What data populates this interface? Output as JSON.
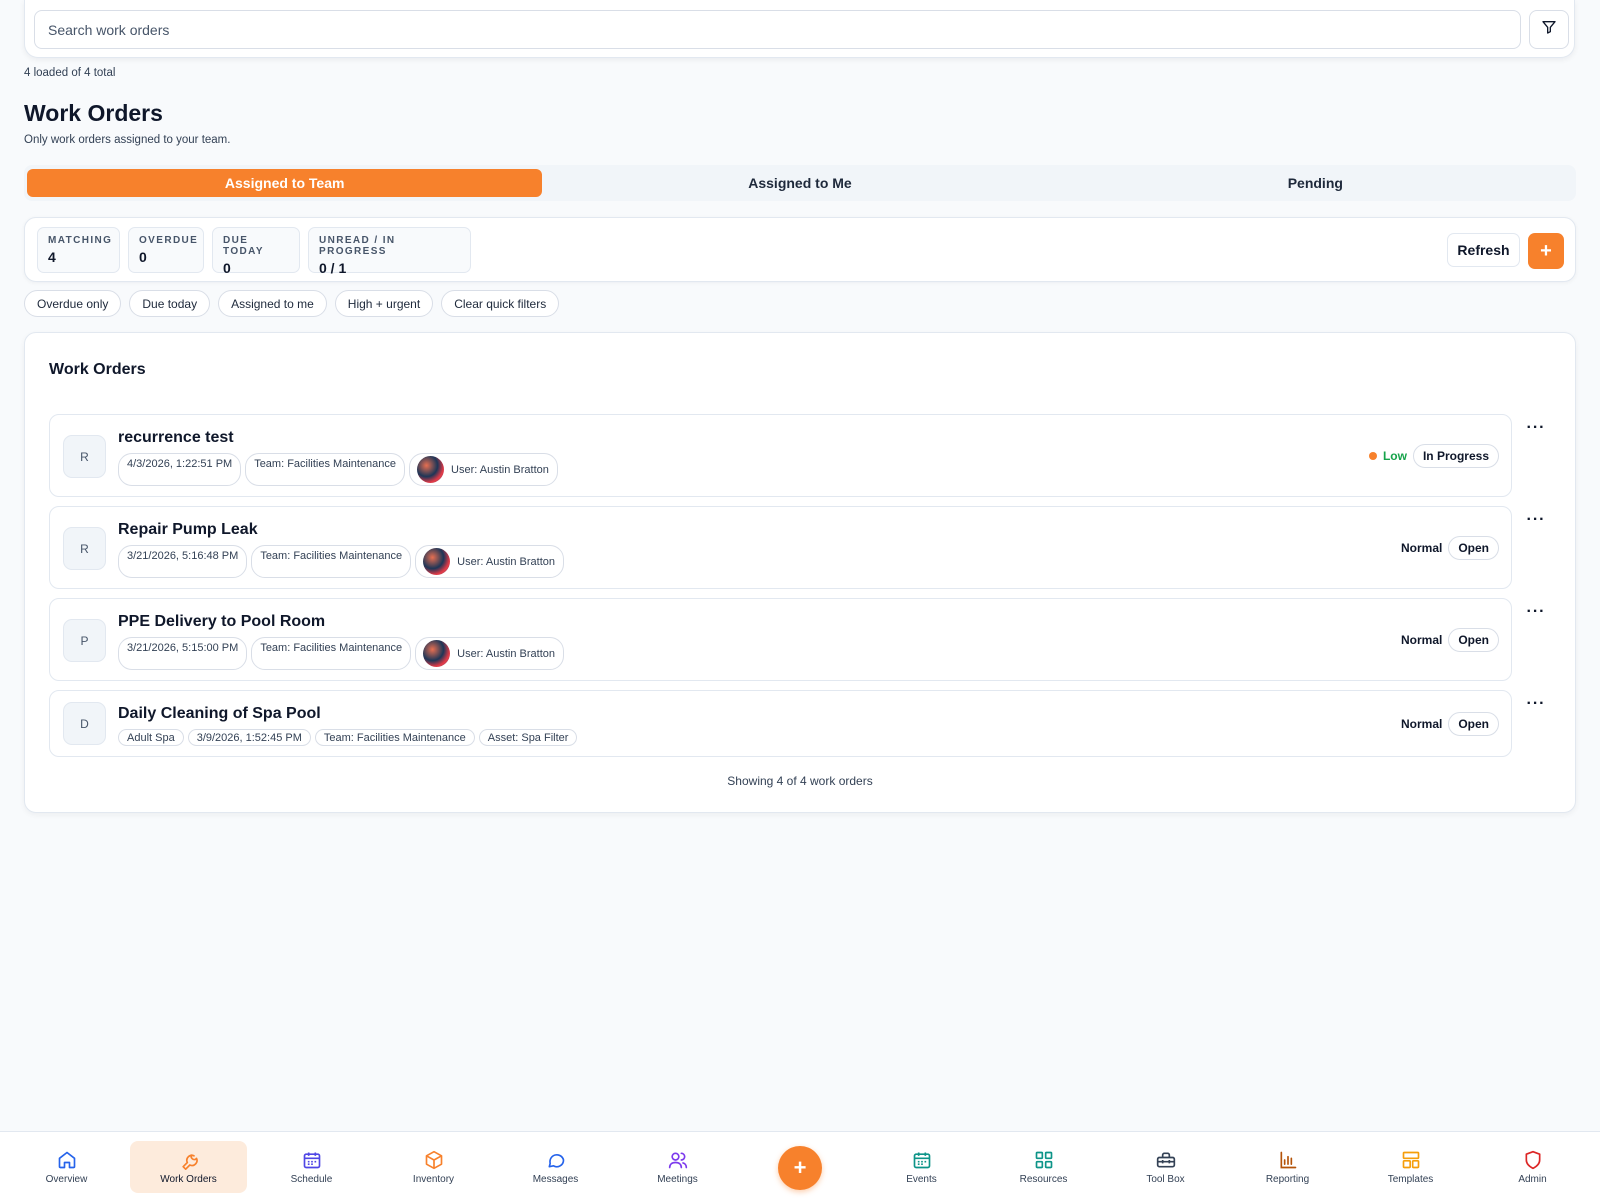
{
  "search": {
    "placeholder": "Search work orders"
  },
  "loaded_count": "4 loaded of 4 total",
  "page": {
    "title": "Work Orders",
    "subtitle": "Only work orders assigned to your team."
  },
  "tabs": [
    {
      "label": "Assigned to Team",
      "active": true
    },
    {
      "label": "Assigned to Me",
      "active": false
    },
    {
      "label": "Pending",
      "active": false
    }
  ],
  "stats": [
    {
      "label": "MATCHING",
      "value": "4"
    },
    {
      "label": "OVERDUE",
      "value": "0"
    },
    {
      "label": "DUE TODAY",
      "value": "0"
    },
    {
      "label": "UNREAD / IN PROGRESS",
      "value": "0 / 1"
    }
  ],
  "actions": {
    "refresh_label": "Refresh",
    "add_label": "+"
  },
  "quick_filters": [
    "Overdue only",
    "Due today",
    "Assigned to me",
    "High + urgent",
    "Clear quick filters"
  ],
  "work_orders": {
    "title": "Work Orders",
    "more_label": "···",
    "rows": [
      {
        "initial": "R",
        "title": "recurrence test",
        "date": "4/3/2026, 1:22:51 PM",
        "team": "Team: Facilities Maintenance",
        "user": "User: Austin Bratton",
        "priority": "Low",
        "status": "In Progress"
      },
      {
        "initial": "R",
        "title": "Repair Pump Leak",
        "date": "3/21/2026, 5:16:48 PM",
        "team": "Team: Facilities Maintenance",
        "user": "User: Austin Bratton",
        "priority": "Normal",
        "status": "Open"
      },
      {
        "initial": "P",
        "title": "PPE Delivery to Pool Room",
        "date": "3/21/2026, 5:15:00 PM",
        "team": "Team: Facilities Maintenance",
        "user": "User: Austin Bratton",
        "priority": "Normal",
        "status": "Open"
      },
      {
        "initial": "D",
        "title": "Daily Cleaning of Spa Pool",
        "location": "Adult Spa",
        "date": "3/9/2026, 1:52:45 PM",
        "team": "Team: Facilities Maintenance",
        "asset": "Asset: Spa Filter",
        "priority": "Normal",
        "status": "Open"
      }
    ],
    "footer": "Showing 4 of 4 work orders"
  },
  "bottom_nav": {
    "items": [
      {
        "label": "Overview",
        "icon": "home-icon",
        "color": "#2563eb"
      },
      {
        "label": "Work Orders",
        "icon": "wrench-icon",
        "color": "#f7812c",
        "active": true
      },
      {
        "label": "Schedule",
        "icon": "calendar-icon",
        "color": "#4f46e5"
      },
      {
        "label": "Inventory",
        "icon": "package-icon",
        "color": "#f7812c"
      },
      {
        "label": "Messages",
        "icon": "message-icon",
        "color": "#2563eb"
      },
      {
        "label": "Meetings",
        "icon": "users-icon",
        "color": "#7c3aed"
      },
      {
        "label": "Events",
        "icon": "calendar-check-icon",
        "color": "#0d9488"
      },
      {
        "label": "Resources",
        "icon": "grid-icon",
        "color": "#0d9488"
      },
      {
        "label": "Tool Box",
        "icon": "toolbox-icon",
        "color": "#334155"
      },
      {
        "label": "Reporting",
        "icon": "bar-chart-icon",
        "color": "#b45309"
      },
      {
        "label": "Templates",
        "icon": "layout-icon",
        "color": "#f59e0b"
      },
      {
        "label": "Admin",
        "icon": "shield-icon",
        "color": "#dc2626"
      }
    ],
    "fab_label": "+"
  },
  "colors": {
    "accent": "#f7812c",
    "low_priority": "#16a34a"
  }
}
